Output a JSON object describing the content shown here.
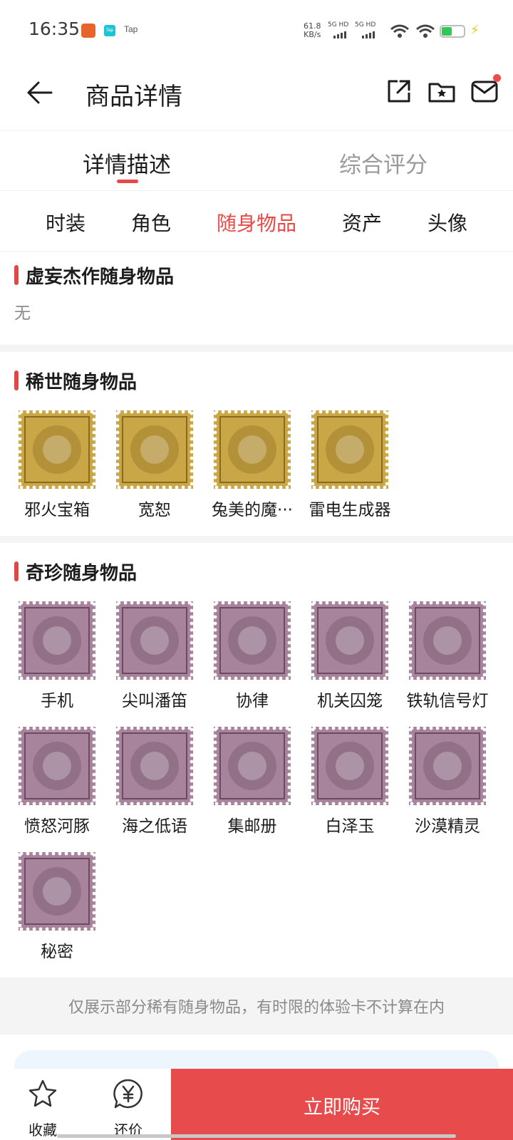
{
  "status_bar": {
    "time": "16:35",
    "tap_label": "Tap",
    "speed_value": "61.8",
    "speed_unit": "KB/s",
    "sim1": "5G HD",
    "sim2": "5G HD",
    "battery_color": "#35c658"
  },
  "header": {
    "title": "商品详情"
  },
  "main_tabs": [
    {
      "label": "详情描述",
      "active": true
    },
    {
      "label": "综合评分",
      "active": false
    }
  ],
  "sub_tabs": [
    {
      "label": "时装"
    },
    {
      "label": "角色"
    },
    {
      "label": "随身物品",
      "active": true
    },
    {
      "label": "资产"
    },
    {
      "label": "头像"
    }
  ],
  "sections": {
    "masterpiece": {
      "title": "虚妄杰作随身物品",
      "empty_text": "无"
    },
    "rare": {
      "title": "稀世随身物品",
      "items": [
        {
          "name": "邪火宝箱",
          "icon": "treasure-chest"
        },
        {
          "name": "宽恕",
          "icon": "staff"
        },
        {
          "name": "兔美的魔···",
          "icon": "magic-wand"
        },
        {
          "name": "雷电生成器",
          "icon": "lightning-generator"
        }
      ]
    },
    "precious": {
      "title": "奇珍随身物品",
      "items": [
        {
          "name": "手机",
          "icon": "phone"
        },
        {
          "name": "尖叫潘笛",
          "icon": "pan-flute"
        },
        {
          "name": "协律",
          "icon": "music-box"
        },
        {
          "name": "机关囚笼",
          "icon": "lantern-cage"
        },
        {
          "name": "铁轨信号灯",
          "icon": "signal-lamp"
        },
        {
          "name": "愤怒河豚",
          "icon": "pufferfish"
        },
        {
          "name": "海之低语",
          "icon": "seashell"
        },
        {
          "name": "集邮册",
          "icon": "stamp-album"
        },
        {
          "name": "白泽玉",
          "icon": "jade-deer"
        },
        {
          "name": "沙漠精灵",
          "icon": "dragonfly"
        },
        {
          "name": "秘密",
          "icon": "secret-orb"
        }
      ]
    }
  },
  "notice": "仅展示部分稀有随身物品，有时限的体验卡不计算在内",
  "bottom_bar": {
    "favorite_label": "收藏",
    "bargain_label": "还价",
    "buy_label": "立即购买"
  },
  "colors": {
    "accent": "#e94848",
    "rare_stamp": "#c9a646",
    "precious_stamp": "#a7849c"
  }
}
